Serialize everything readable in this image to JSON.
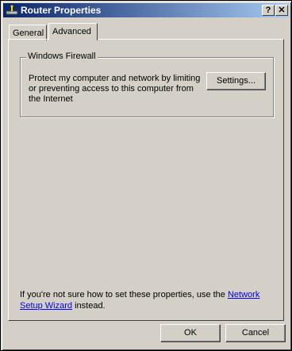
{
  "window": {
    "title": "Router Properties",
    "title_icon": "router-icon",
    "help_button": "?",
    "close_button": "✕"
  },
  "tabs": [
    {
      "label": "General",
      "selected": false
    },
    {
      "label": "Advanced",
      "selected": true
    }
  ],
  "firewall_group": {
    "title": "Windows Firewall",
    "description": "Protect my computer and network by limiting or preventing access to this computer from the Internet",
    "settings_button": "Settings..."
  },
  "footer": {
    "text_before": "If you're not sure how to set these properties, use the ",
    "link": "Network Setup Wizard",
    "text_after": " instead."
  },
  "buttons": {
    "ok": "OK",
    "cancel": "Cancel"
  },
  "colors": {
    "titlebar_start": "#0a246a",
    "titlebar_end": "#a6caf0",
    "face": "#d4d0c8",
    "link": "#0000ee"
  }
}
